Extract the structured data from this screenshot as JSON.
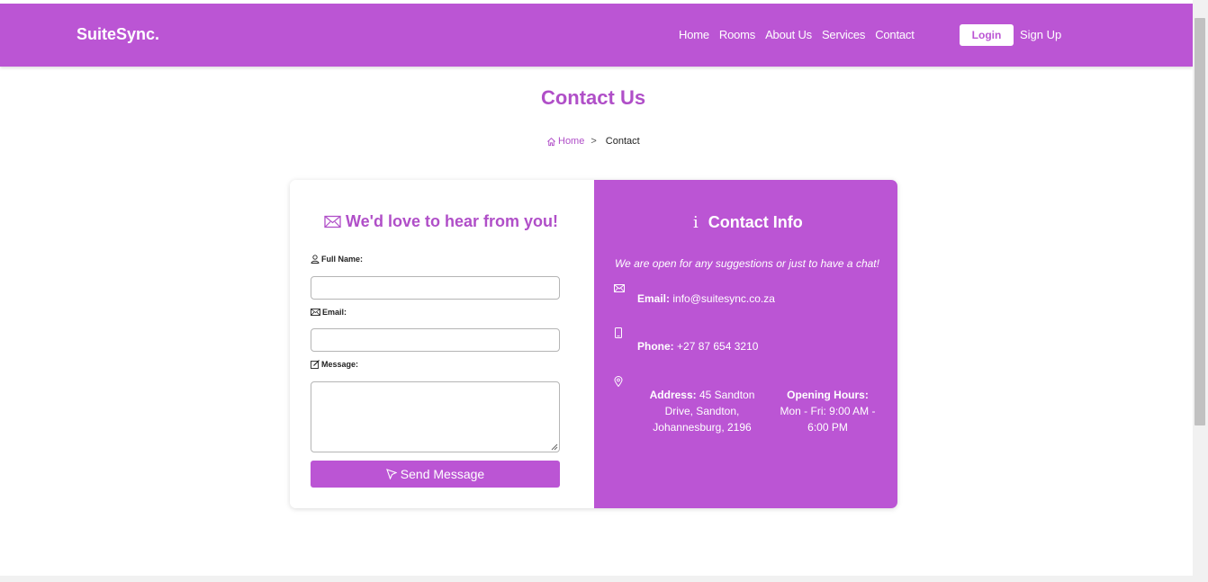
{
  "brand": "SuiteSync.",
  "nav": {
    "links": [
      "Home",
      "Rooms",
      "About Us",
      "Services",
      "Contact"
    ],
    "login": "Login",
    "signup": "Sign Up"
  },
  "page_title": "Contact Us",
  "breadcrumb": {
    "home": "Home",
    "separator": ">",
    "current": "Contact"
  },
  "form": {
    "heading": "We'd love to hear from you!",
    "full_name_label": "Full Name:",
    "email_label": "Email:",
    "message_label": "Message:",
    "full_name_value": "",
    "email_value": "",
    "message_value": "",
    "send_label": "Send Message"
  },
  "info": {
    "heading": "Contact Info",
    "intro": "We are open for any suggestions or just to have a chat!",
    "email_label": "Email:",
    "email_value": "info@suitesync.co.za",
    "phone_label": "Phone:",
    "phone_value": "+27 87 654 3210",
    "address_label": "Address:",
    "address_line1": "45 Sandton",
    "address_line2": "Drive, Sandton,",
    "address_line3": "Johannesburg, 2196",
    "hours_label": "Opening Hours:",
    "hours_line1": "Mon - Fri: 9:00 AM -",
    "hours_line2": "6:00 PM"
  },
  "colors": {
    "accent": "#bb55d4",
    "accent_text": "#b04fc8"
  }
}
